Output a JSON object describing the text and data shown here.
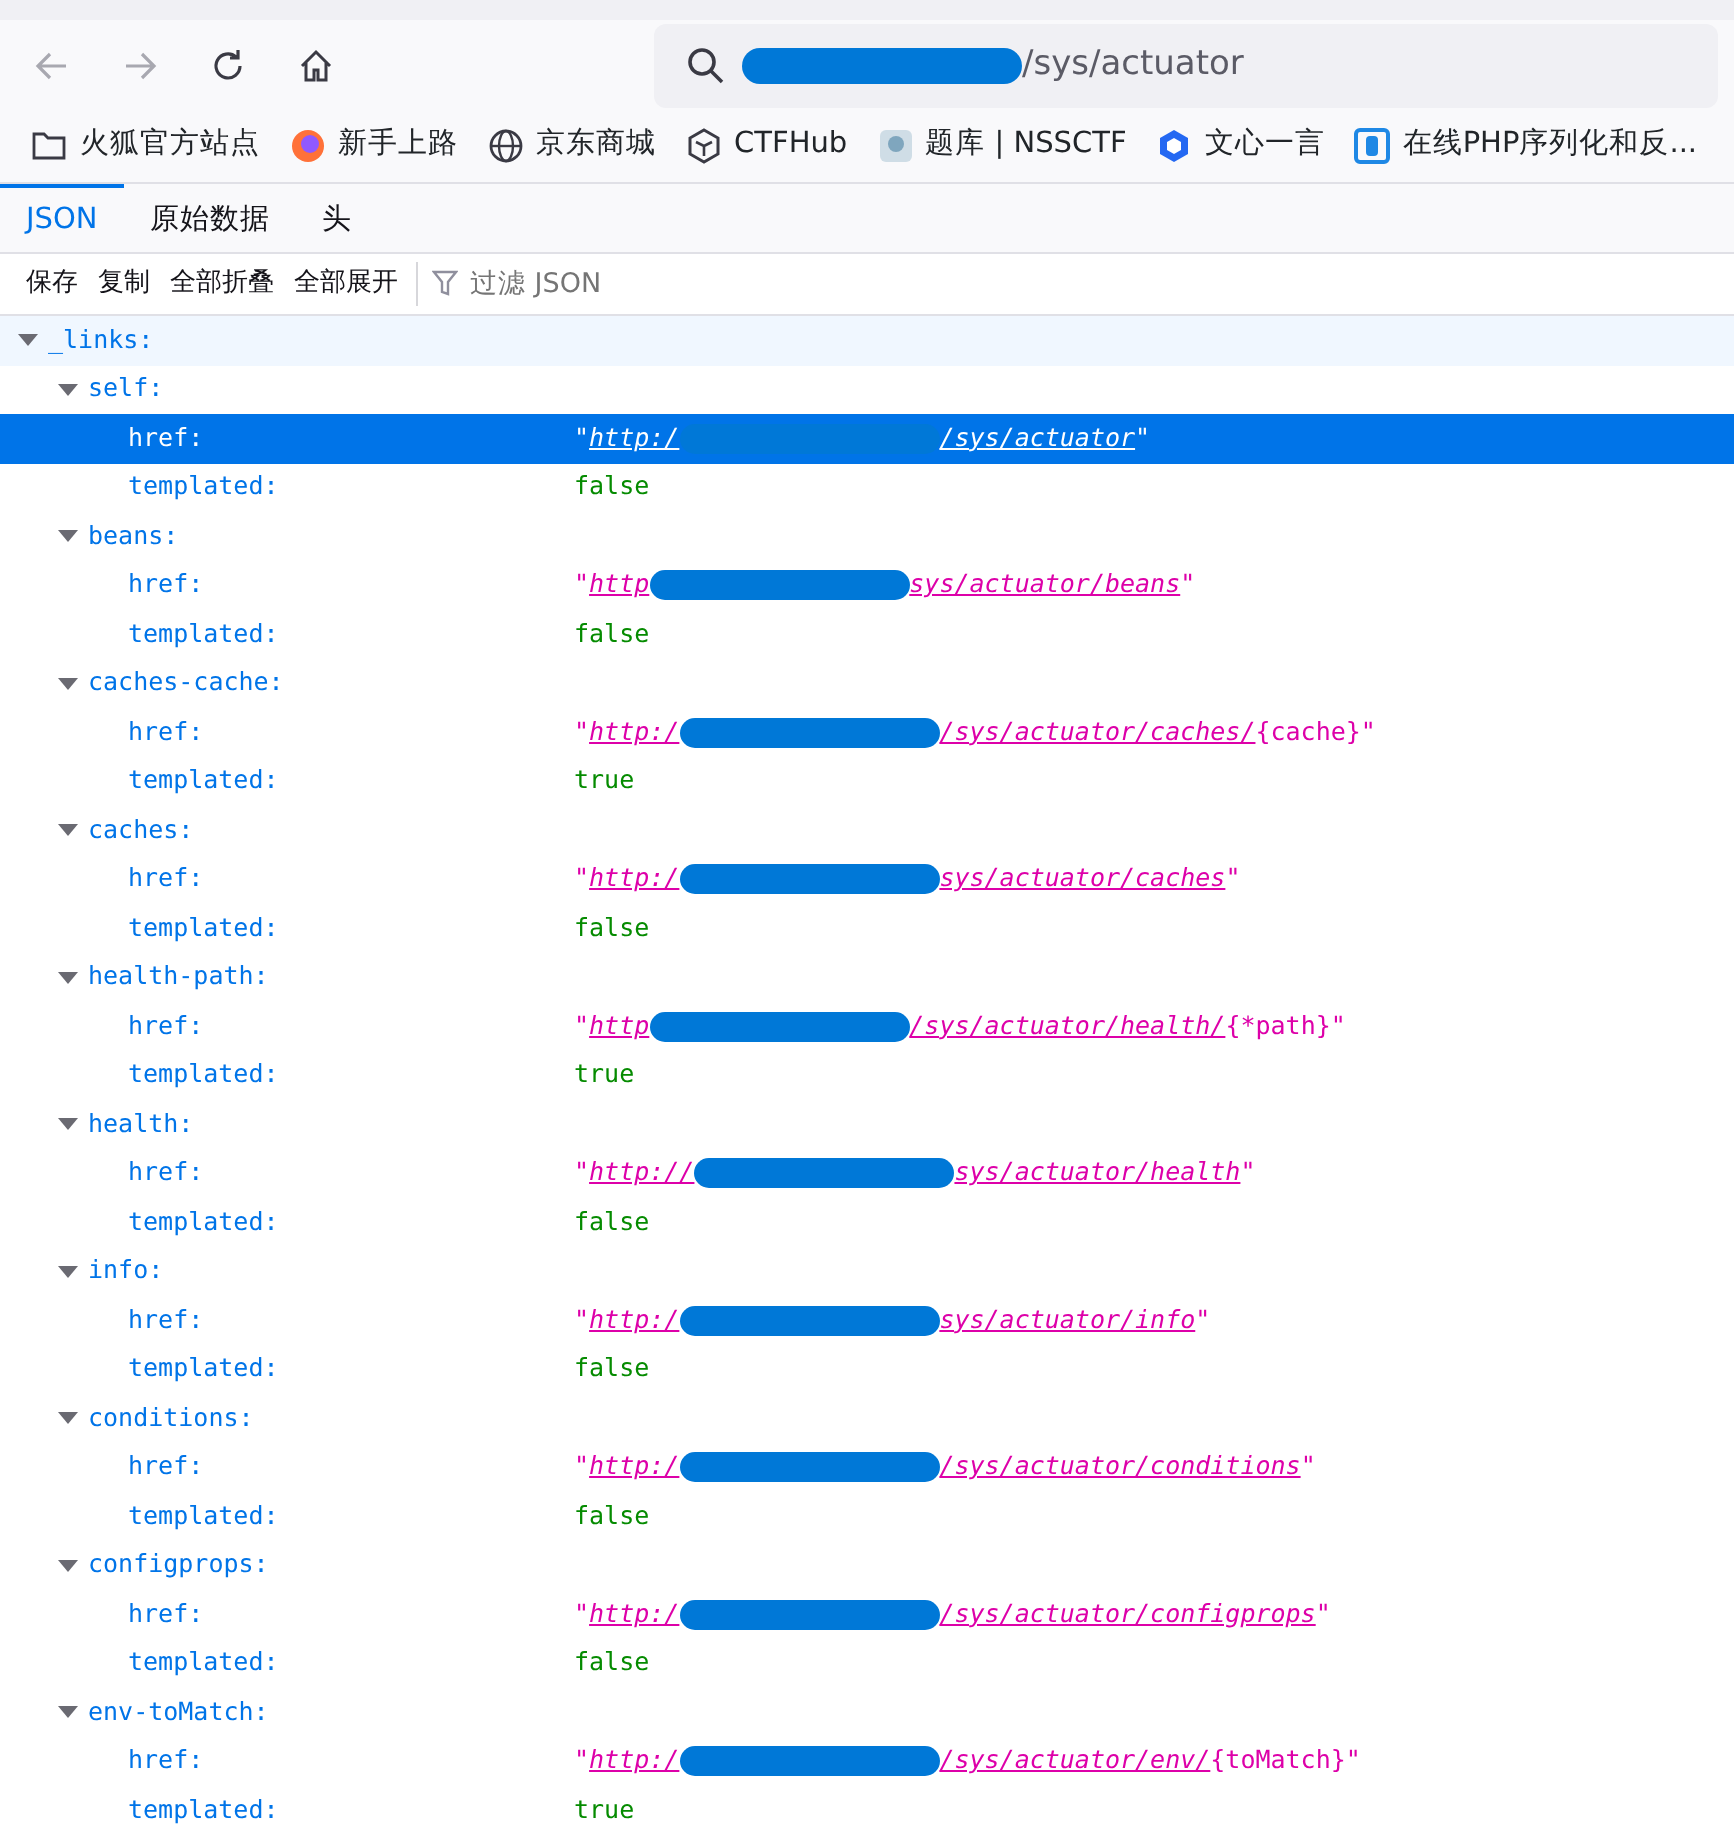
{
  "nav_buttons": [
    {
      "kind": "back",
      "disabled": true
    },
    {
      "kind": "forward",
      "disabled": true
    },
    {
      "kind": "reload",
      "disabled": false
    },
    {
      "kind": "home",
      "disabled": false
    }
  ],
  "address_bar": {
    "redacted": true,
    "end": "/sys/actuator"
  },
  "bookmarks": [
    {
      "label": "火狐官方站点"
    },
    {
      "label": "新手上路"
    },
    {
      "label": "京东商城"
    },
    {
      "label": "CTFHub"
    },
    {
      "label": "题库 | NSSCTF"
    },
    {
      "label": "文心一言"
    },
    {
      "label": "在线PHP序列化和反..."
    }
  ],
  "quote_mark": "\"",
  "viewer_tabs": [
    {
      "label": "JSON",
      "selected": true
    },
    {
      "label": "原始数据",
      "selected": false
    },
    {
      "label": "头",
      "selected": false
    }
  ],
  "toolbar": [
    "保存",
    "复制",
    "全部折叠",
    "全部展开"
  ],
  "filter": {
    "placeholder": "过滤 JSON"
  },
  "tree": [
    {
      "key": "_links:",
      "expanded": true,
      "highlighted": true,
      "children": [
        {
          "key": "self:",
          "expanded": true,
          "children": [
            {
              "key": "href:",
              "kind": "link",
              "start": "http:/",
              "redacted": true,
              "end": "/sys/actuator",
              "selected": true
            },
            {
              "key": "templated:",
              "kind": "bool",
              "value": "false",
              "selected": false
            }
          ]
        },
        {
          "key": "beans:",
          "expanded": true,
          "children": [
            {
              "key": "href:",
              "kind": "link",
              "start": "http",
              "redacted": true,
              "end": "sys/actuator/beans",
              "selected": false
            },
            {
              "key": "templated:",
              "kind": "bool",
              "value": "false",
              "selected": false
            }
          ]
        },
        {
          "key": "caches-cache:",
          "expanded": true,
          "children": [
            {
              "key": "href:",
              "kind": "link",
              "start": "http:/",
              "redacted": true,
              "end": "/sys/actuator/caches/",
              "template": "{cache}",
              "selected": false
            },
            {
              "key": "templated:",
              "kind": "bool",
              "value": "true",
              "selected": false
            }
          ]
        },
        {
          "key": "caches:",
          "expanded": true,
          "children": [
            {
              "key": "href:",
              "kind": "link",
              "start": "http:/",
              "redacted": true,
              "end": "sys/actuator/caches",
              "selected": false
            },
            {
              "key": "templated:",
              "kind": "bool",
              "value": "false",
              "selected": false
            }
          ]
        },
        {
          "key": "health-path:",
          "expanded": true,
          "children": [
            {
              "key": "href:",
              "kind": "link",
              "start": "http",
              "redacted": true,
              "end": "/sys/actuator/health/",
              "template": "{*path}",
              "selected": false
            },
            {
              "key": "templated:",
              "kind": "bool",
              "value": "true",
              "selected": false
            }
          ]
        },
        {
          "key": "health:",
          "expanded": true,
          "children": [
            {
              "key": "href:",
              "kind": "link",
              "start": "http://",
              "redacted": true,
              "end": "sys/actuator/health",
              "selected": false
            },
            {
              "key": "templated:",
              "kind": "bool",
              "value": "false",
              "selected": false
            }
          ]
        },
        {
          "key": "info:",
          "expanded": true,
          "children": [
            {
              "key": "href:",
              "kind": "link",
              "start": "http:/",
              "redacted": true,
              "end": "sys/actuator/info",
              "selected": false
            },
            {
              "key": "templated:",
              "kind": "bool",
              "value": "false",
              "selected": false
            }
          ]
        },
        {
          "key": "conditions:",
          "expanded": true,
          "children": [
            {
              "key": "href:",
              "kind": "link",
              "start": "http:/",
              "redacted": true,
              "end": "/sys/actuator/conditions",
              "selected": false
            },
            {
              "key": "templated:",
              "kind": "bool",
              "value": "false",
              "selected": false
            }
          ]
        },
        {
          "key": "configprops:",
          "expanded": true,
          "children": [
            {
              "key": "href:",
              "kind": "link",
              "start": "http:/",
              "redacted": true,
              "end": "/sys/actuator/configprops",
              "selected": false
            },
            {
              "key": "templated:",
              "kind": "bool",
              "value": "false",
              "selected": false
            }
          ]
        },
        {
          "key": "env-toMatch:",
          "expanded": true,
          "children": [
            {
              "key": "href:",
              "kind": "link",
              "start": "http:/",
              "redacted": true,
              "end": "/sys/actuator/env/",
              "template": "{toMatch}",
              "selected": false
            },
            {
              "key": "templated:",
              "kind": "bool",
              "value": "true",
              "selected": false
            }
          ]
        }
      ]
    }
  ]
}
